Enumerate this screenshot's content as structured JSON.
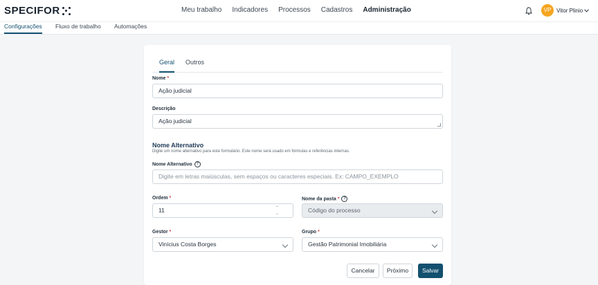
{
  "brand": {
    "name": "SPECIFOR"
  },
  "mainnav": [
    "Meu trabalho",
    "Indicadores",
    "Processos",
    "Cadastros",
    "Administração"
  ],
  "user": {
    "initials": "VP",
    "name": "Vitor Plinio"
  },
  "subnav": [
    "Configurações",
    "Fluxo de trabalho",
    "Automações"
  ],
  "form": {
    "tabs": [
      "Geral",
      "Outros"
    ],
    "nome": {
      "label": "Nome",
      "required": "*",
      "value": "Ação judicial"
    },
    "descricao": {
      "label": "Descrição",
      "value": "Ação judicial"
    },
    "alt_section": {
      "title": "Nome Alternativo",
      "desc": "Digite um nome alternativo para este formulário. Este nome será usado em fórmulas e referências internas."
    },
    "nome_alternativo": {
      "label": "Nome Alternativo",
      "placeholder": "Digite em letras maiúsculas, sem espaços ou caracteres especiais. Ex: CAMPO_EXEMPLO"
    },
    "ordem": {
      "label": "Ordem",
      "required": "*",
      "value": "11"
    },
    "nome_pasta": {
      "label": "Nome da pasta",
      "required": "*",
      "value": "Código do processo"
    },
    "gestor": {
      "label": "Gestor",
      "required": "*",
      "value": "Vinícius Costa Borges"
    },
    "grupo": {
      "label": "Grupo",
      "required": "*",
      "value": "Gestão Patrimonial Imobiliária"
    }
  },
  "buttons": {
    "cancel": "Cancelar",
    "next": "Próximo",
    "save": "Salvar"
  },
  "colors": {
    "primary": "#13506f",
    "avatar": "#f5a623",
    "required": "#d64545"
  }
}
